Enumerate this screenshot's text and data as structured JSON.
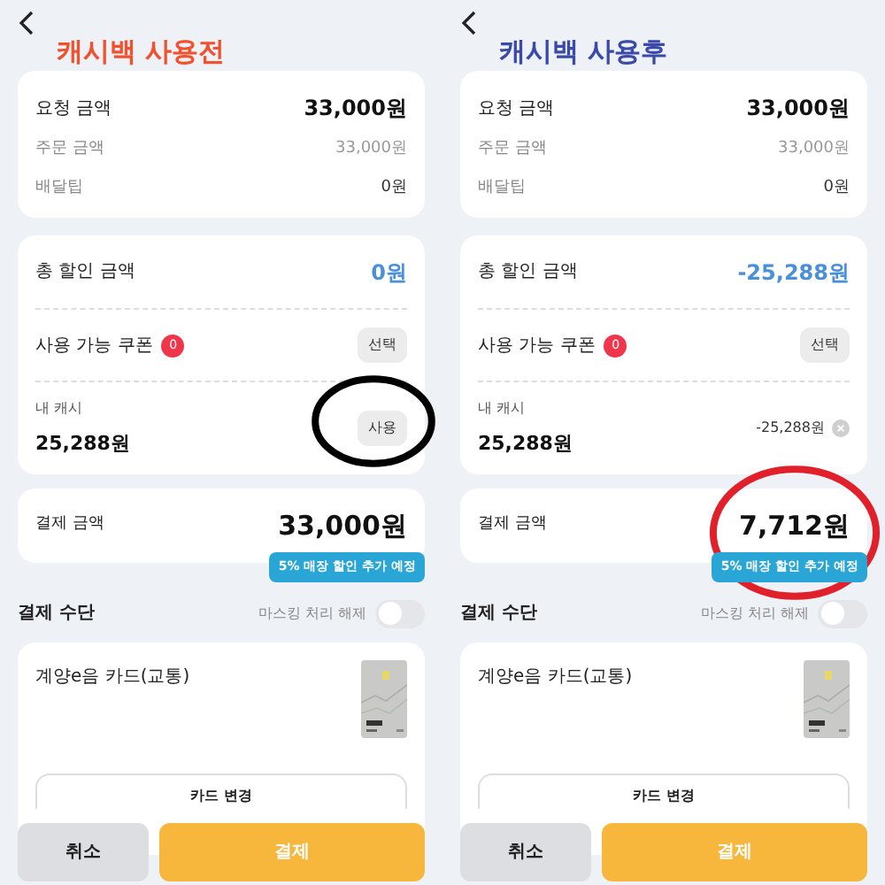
{
  "panels": [
    {
      "title": "캐시백 사용전",
      "color": "#f0522f",
      "annotation": {
        "kind": "cash",
        "color": "#000000"
      },
      "summary": {
        "main": {
          "label": "요청 금액",
          "value": "33,000원"
        },
        "rows": [
          {
            "label": "주문 금액",
            "value": "33,000원"
          },
          {
            "label": "배달팁",
            "value": "0원"
          }
        ]
      },
      "discount": {
        "label": "총 할인 금액",
        "value": "0원"
      },
      "coupon": {
        "label": "사용 가능 쿠폰",
        "count": "0",
        "button": "선택"
      },
      "cash": {
        "label": "내 캐시",
        "amount": "25,288원",
        "action": {
          "kind": "button",
          "label": "사용"
        }
      },
      "payment": {
        "label": "결제 금액",
        "amount": "33,000원",
        "badge": "5% 매장 할인 추가 예정"
      },
      "method": {
        "title": "결제 수단",
        "toggle_label": "마스킹 처리 해제",
        "on": false,
        "card_name": "계양e음 카드(교통)",
        "change_button": "카드 변경"
      },
      "buttons": [
        {
          "label": "취소",
          "kind": "secondary"
        },
        {
          "label": "결제",
          "kind": "primary"
        }
      ]
    },
    {
      "title": "캐시백 사용후",
      "color": "#3a4aa8",
      "annotation": {
        "kind": "payment",
        "color": "#e0202a"
      },
      "summary": {
        "main": {
          "label": "요청 금액",
          "value": "33,000원"
        },
        "rows": [
          {
            "label": "주문 금액",
            "value": "33,000원"
          },
          {
            "label": "배달팁",
            "value": "0원"
          }
        ]
      },
      "discount": {
        "label": "총 할인 금액",
        "value": "-25,288원"
      },
      "coupon": {
        "label": "사용 가능 쿠폰",
        "count": "0",
        "button": "선택"
      },
      "cash": {
        "label": "내 캐시",
        "amount": "25,288원",
        "action": {
          "kind": "applied",
          "value": "-25,288원"
        }
      },
      "payment": {
        "label": "결제 금액",
        "amount": "7,712원",
        "badge": "5% 매장 할인 추가 예정"
      },
      "method": {
        "title": "결제 수단",
        "toggle_label": "마스킹 처리 해제",
        "on": false,
        "card_name": "계양e음 카드(교통)",
        "change_button": "카드 변경"
      },
      "buttons": [
        {
          "label": "취소",
          "kind": "secondary"
        },
        {
          "label": "결제",
          "kind": "primary"
        }
      ]
    }
  ]
}
